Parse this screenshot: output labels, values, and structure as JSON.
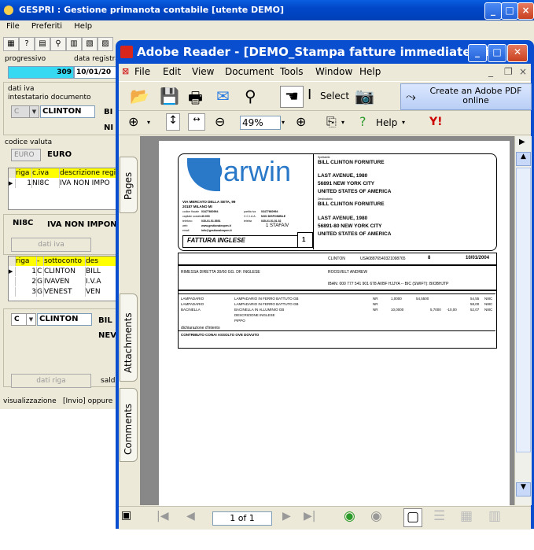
{
  "gespri": {
    "title": "GESPRI : Gestione primanota contabile [utente DEMO]",
    "menu": [
      "File",
      "Preferiti",
      "Help"
    ],
    "progressivo_label": "progressivo",
    "progressivo_value": "309",
    "data_registrazione_label": "data registra",
    "data_registrazione_value": "10/01/20",
    "dati_iva_label": "dati iva",
    "intestatario_label": "intestatario documento",
    "intestatario_combo": "C",
    "intestatario_code": "CLINTON",
    "intestatario_name_trunc": "BI",
    "ni_trunc": "NI",
    "codice_valuta_label": "codice valuta",
    "valuta_combo": "EURO",
    "valuta_value": "EURO",
    "iva_grid": {
      "headers": [
        "riga",
        "c.iva",
        "descrizione regi"
      ],
      "rows": [
        [
          "1",
          "NI8C",
          "IVA NON IMPO"
        ]
      ]
    },
    "iva_code": "NI8C",
    "iva_desc": "IVA NON IMPONI",
    "dati_iva_button": "dati iva",
    "righe_grid": {
      "headers": [
        "riga",
        "-",
        "sottoconto",
        "des"
      ],
      "rows": [
        [
          "1",
          "C",
          "CLINTON",
          "BILL"
        ],
        [
          "2",
          "G",
          "IVAVEN",
          "I.V.A"
        ],
        [
          "3",
          "G",
          "VENEST",
          "VEN"
        ]
      ]
    },
    "riga_combo": "C",
    "riga_code": "CLINTON",
    "riga_name_trunc": "BIL",
    "riga_nev_trunc": "NEV",
    "dati_riga_button": "dati riga",
    "saldo_trunc": "sald",
    "status_text": "visualizzazione",
    "status_hint": "[Invio] oppure"
  },
  "reader": {
    "title": "Adobe Reader - [DEMO_Stampa fatture immediate clien...",
    "menu": [
      "File",
      "Edit",
      "View",
      "Document",
      "Tools",
      "Window",
      "Help"
    ],
    "select_label": "Select",
    "create_pdf_label": "Create an Adobe PDF online",
    "zoom": "49%",
    "help_label": "Help",
    "side_tabs": [
      "Pages",
      "Attachments",
      "Comments"
    ],
    "page_indicator": "1 of 1"
  },
  "invoice": {
    "logo_text": "Darwin",
    "company_address": [
      "VIA MERCATO DELLA SETA, 99",
      "20187 MILANO MI"
    ],
    "company_contacts": [
      [
        "codice fiscale",
        "03477660994",
        "partita iva",
        "03477660994"
      ],
      [
        "capitale sociale",
        "40.000",
        "C.C.I.A.A.",
        "NON DISPONIBILE"
      ],
      [
        "telefono",
        "035-01.51.5551",
        "telefax",
        "035-01.51.51.52"
      ],
      [
        "web",
        "www.gestionaleopen.it",
        "",
        "1 STAFAIV"
      ],
      [
        "email",
        "info@gestionaleopen.it",
        "",
        ""
      ]
    ],
    "doc_type": "FATTURA INGLESE",
    "doc_number": "1",
    "spett_label": "Spettabile",
    "recipient": [
      "BILL CLINTON FORNITURE",
      "",
      "LAST AVENUE, 1980",
      "56891 NEW YORK CITY",
      "UNITED STATES OF AMERICA"
    ],
    "dest_label": "Destinatario",
    "destination": [
      "BILL CLINTON FORNITURE",
      "",
      "LAST AVENUE, 1980",
      "56891-80 NEW YORK CITY",
      "UNITED STATES OF AMERICA"
    ],
    "info_row": [
      "CLINTON",
      "USA08876540321098765",
      "8",
      "10/01/2004"
    ],
    "payment": "RIMESSA DIRETTA 30/60 GG. DF. INGLESE",
    "agent": "ROOSVELT ANDREW",
    "iban": "IBAN: 000 777 541 901 678 AVBF HJJYA -- BIC (SWIFT): BIOBHJTP",
    "lines": [
      [
        "LAMPADARIO",
        "LAMPADARIO IN FERRO BATTUTO GB",
        "NR",
        "1,0000",
        "54,5500",
        "",
        "54,55",
        "NI8C"
      ],
      [
        "LAMPADARIO",
        "LAMPADARIO IN FERRO BATTUTO GB",
        "NR",
        "",
        "",
        "",
        "58,00",
        "NI8C"
      ],
      [
        "BACINELLA",
        "BACINELLA IN ALLUMINIO GB",
        "NR",
        "10,0000",
        "5,7000",
        "-10,00",
        "52,07",
        "NI8C"
      ],
      [
        "",
        "DESCRIZIONE INGLESE",
        "",
        "",
        "",
        "",
        "",
        ""
      ],
      [
        "",
        "PIPPO",
        "",
        "",
        "",
        "",
        "",
        ""
      ]
    ],
    "declaration": "dichiarazione d'intento",
    "contribution": "CONTRIBUTO CONAI ASSOLTO OVE DOVUTO"
  }
}
